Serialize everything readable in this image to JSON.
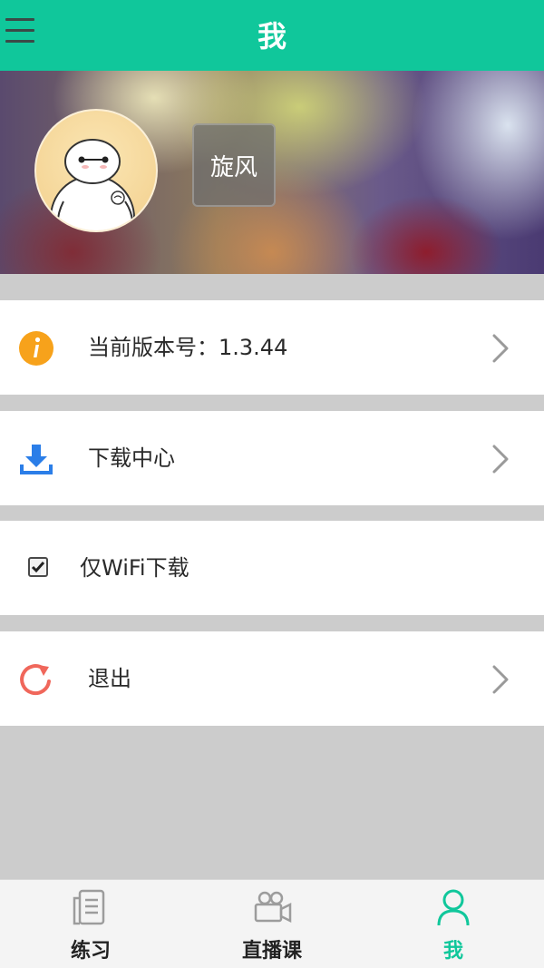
{
  "header": {
    "title": "我",
    "menu_icon": "menu-icon"
  },
  "profile": {
    "username": "旋风",
    "avatar_icon": "baymax-avatar"
  },
  "settings": {
    "version_label": "当前版本号：1.3.44",
    "version_icon": "info-icon",
    "download_center_label": "下载中心",
    "download_icon": "download-icon",
    "wifi_only_label": "仅WiFi下载",
    "wifi_only_checked": true,
    "logout_label": "退出",
    "logout_icon": "logout-icon"
  },
  "tabs": [
    {
      "label": "练习",
      "icon": "document-icon",
      "active": false
    },
    {
      "label": "直播课",
      "icon": "video-camera-icon",
      "active": false
    },
    {
      "label": "我",
      "icon": "user-icon",
      "active": true
    }
  ],
  "colors": {
    "brand": "#10c79b",
    "info": "#f7a21b",
    "download": "#2b7ee8",
    "logout": "#f0675b",
    "background": "#cccccc"
  }
}
